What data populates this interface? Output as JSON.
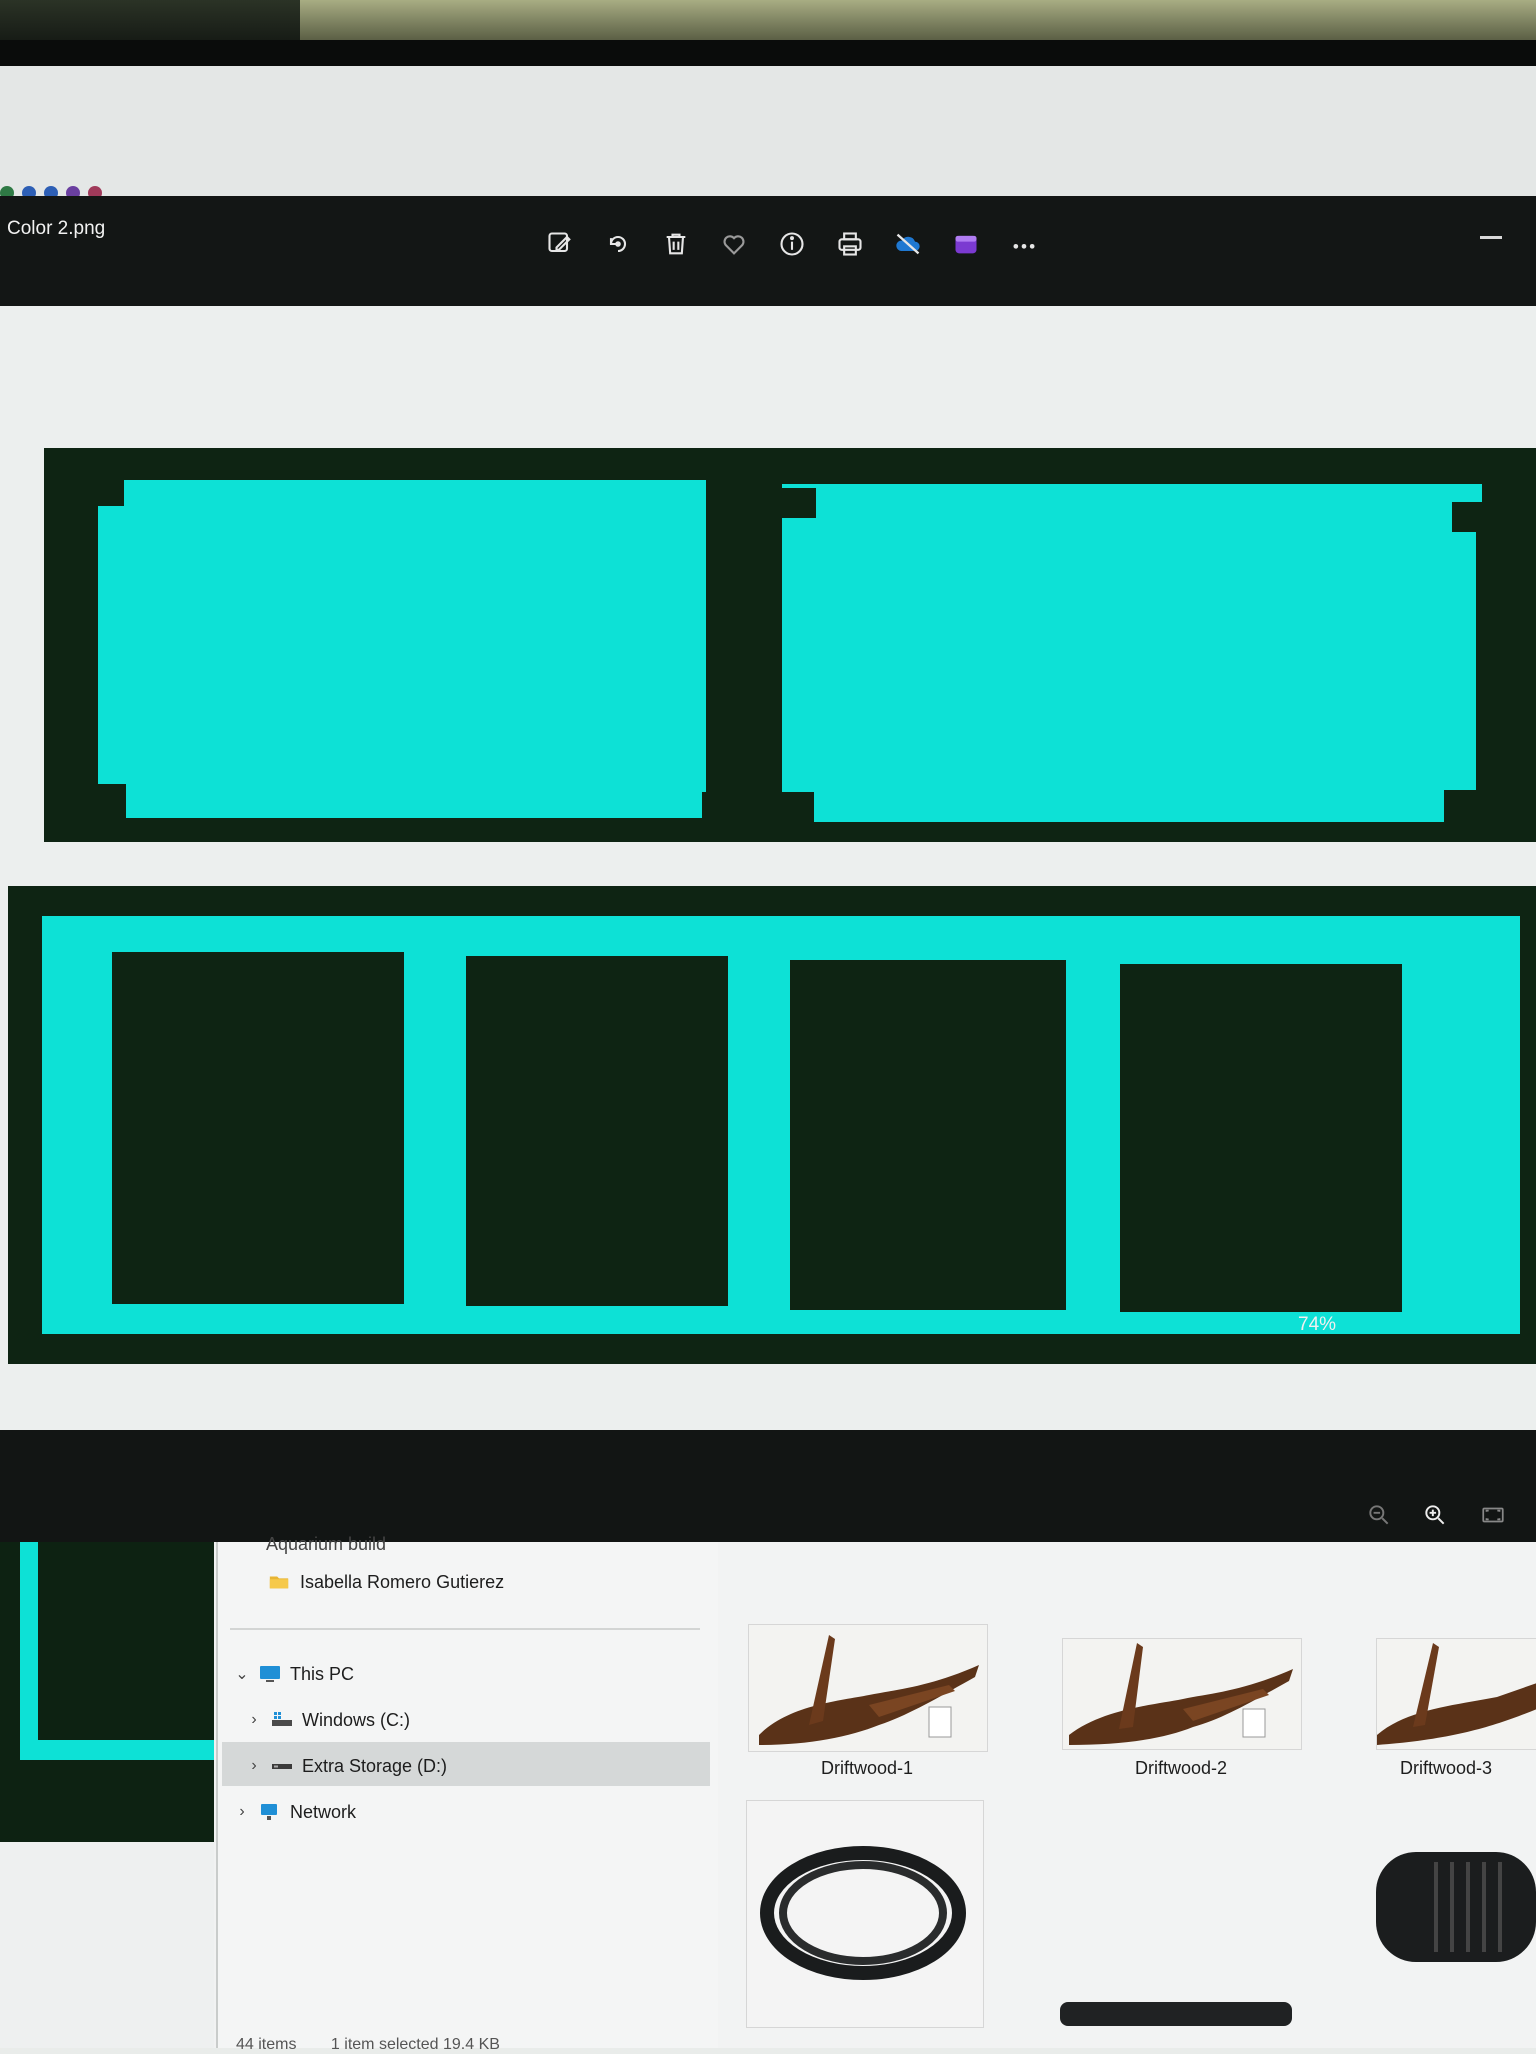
{
  "window": {
    "title": "Color 2.png",
    "toolbar": [
      {
        "name": "edit-image-icon"
      },
      {
        "name": "rotate-icon"
      },
      {
        "name": "delete-icon"
      },
      {
        "name": "favorite-icon"
      },
      {
        "name": "info-icon"
      },
      {
        "name": "print-icon"
      },
      {
        "name": "onedrive-sync-off-icon"
      },
      {
        "name": "clipchamp-icon"
      },
      {
        "name": "more-options-icon"
      }
    ]
  },
  "status": {
    "zoom": "74%"
  },
  "explorer": {
    "nav": {
      "partial_folder": "Aquarium build",
      "folder": "Isabella Romero Gutierez",
      "this_pc": "This PC",
      "drive_c": "Windows (C:)",
      "drive_d": "Extra Storage (D:)",
      "network": "Network"
    },
    "files": [
      {
        "label": "Driftwood-1"
      },
      {
        "label": "Driftwood-2"
      },
      {
        "label": "Driftwood-3"
      }
    ],
    "status": {
      "count": "44 items",
      "selected": "1 item selected  19.4 KB"
    }
  },
  "colors": {
    "dark_green": "#0e2413",
    "cyan": "#0de1d6",
    "titlebar": "#131615"
  }
}
